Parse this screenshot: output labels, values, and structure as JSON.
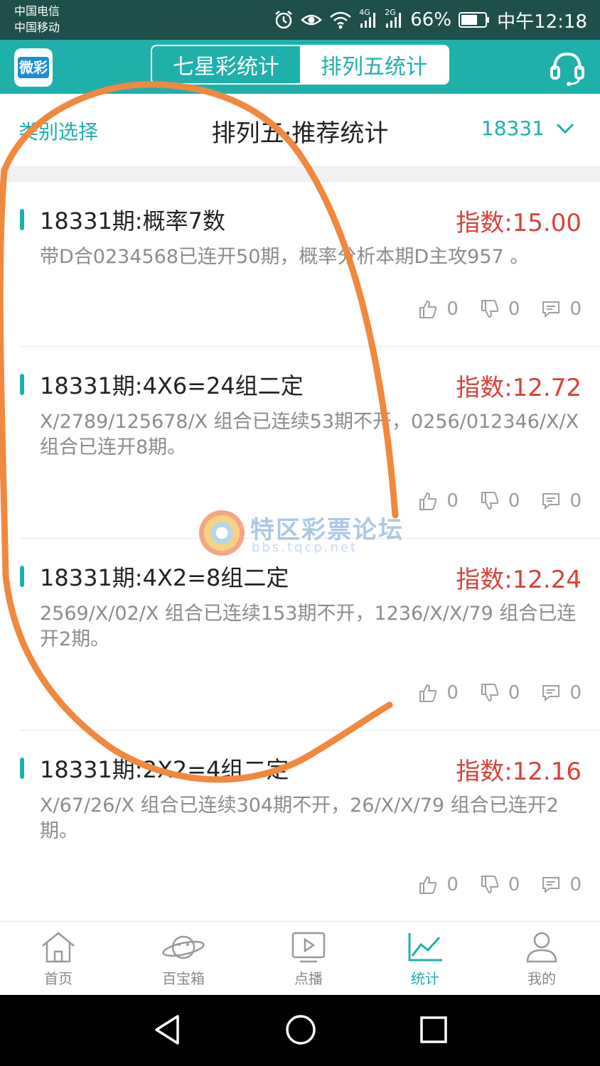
{
  "status_bar": {
    "carrier1": "中国电信",
    "carrier2": "中国移动",
    "net1": "4G",
    "net2": "2G",
    "battery": "66%",
    "time": "中午12:18"
  },
  "header": {
    "logo_text": "微彩",
    "tabs": [
      {
        "label": "七星彩统计",
        "active": false
      },
      {
        "label": "排列五统计",
        "active": true
      }
    ]
  },
  "sub_header": {
    "category_label": "类别选择",
    "title": "排列五·推荐统计",
    "issue": "18331"
  },
  "cards": [
    {
      "title": "18331期:概率7数",
      "index": "指数:15.00",
      "desc": "带D合0234568已连开50期，概率分析本期D主攻957 。",
      "likes": "0",
      "dislikes": "0",
      "comments": "0"
    },
    {
      "title": "18331期:4X6=24组二定",
      "index": "指数:12.72",
      "desc": "X/2789/125678/X 组合已连续53期不开，0256/012346/X/X 组合已连开8期。",
      "likes": "0",
      "dislikes": "0",
      "comments": "0"
    },
    {
      "title": "18331期:4X2=8组二定",
      "index": "指数:12.24",
      "desc": "2569/X/02/X 组合已连续153期不开，1236/X/X/79 组合已连开2期。",
      "likes": "0",
      "dislikes": "0",
      "comments": "0"
    },
    {
      "title": "18331期:2X2=4组二定",
      "index": "指数:12.16",
      "desc": "X/67/26/X 组合已连续304期不开，26/X/X/79 组合已连开2期。",
      "likes": "0",
      "dislikes": "0",
      "comments": "0"
    }
  ],
  "watermark": {
    "title": "特区彩票论坛",
    "url": "bbs.tqcp.net"
  },
  "bottom_nav": [
    {
      "label": "首页",
      "icon": "home-icon",
      "active": false
    },
    {
      "label": "百宝箱",
      "icon": "planet-icon",
      "active": false
    },
    {
      "label": "点播",
      "icon": "play-icon",
      "active": false
    },
    {
      "label": "统计",
      "icon": "chart-icon",
      "active": true
    },
    {
      "label": "我的",
      "icon": "user-icon",
      "active": false
    }
  ],
  "colors": {
    "brand": "#1fb0ac",
    "index_red": "#d9423a",
    "annotation": "#f0883e"
  }
}
